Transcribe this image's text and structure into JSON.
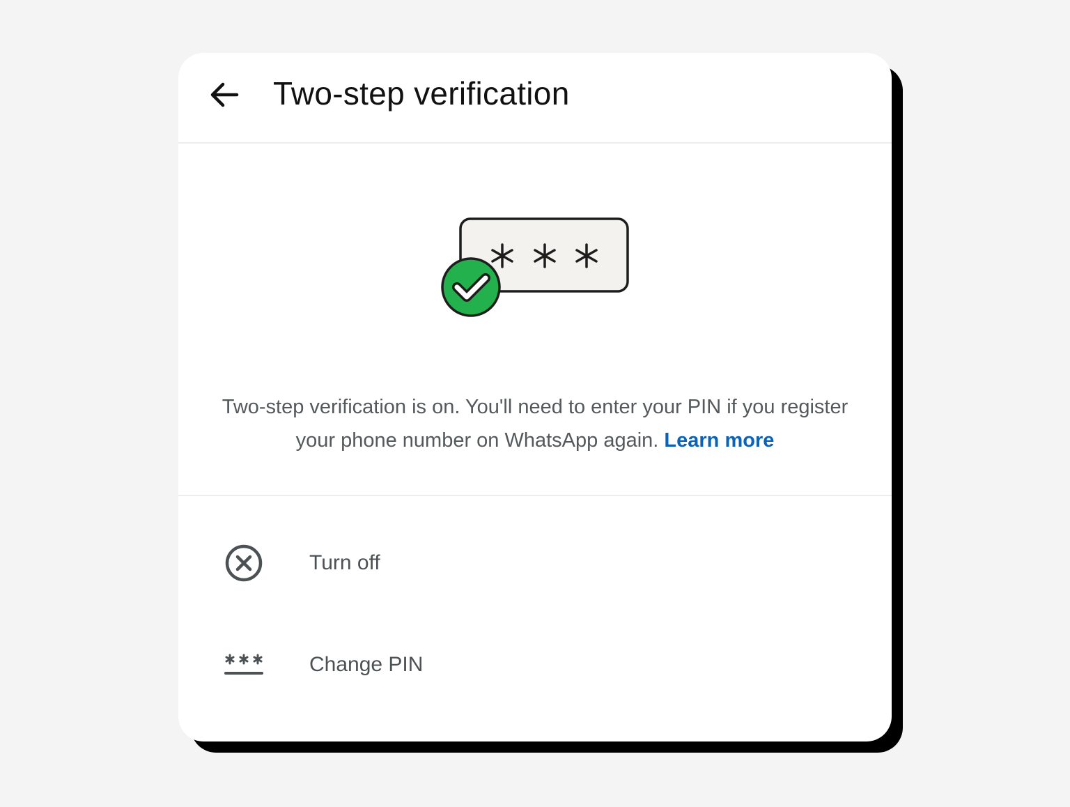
{
  "header": {
    "back_icon": "arrow-left-icon",
    "title": "Two-step verification"
  },
  "illustration": {
    "pin_mask": "* * *",
    "badge_icon": "check-circle-icon",
    "badge_color": "#22b14c"
  },
  "description": {
    "text": "Two-step verification is on. You'll need to enter your PIN if you register your phone number on WhatsApp again.",
    "link_label": "Learn more",
    "link_color": "#0a63b8"
  },
  "options": [
    {
      "icon": "close-circle-icon",
      "label": "Turn off"
    },
    {
      "icon": "pin-dots-icon",
      "label": "Change PIN"
    }
  ]
}
